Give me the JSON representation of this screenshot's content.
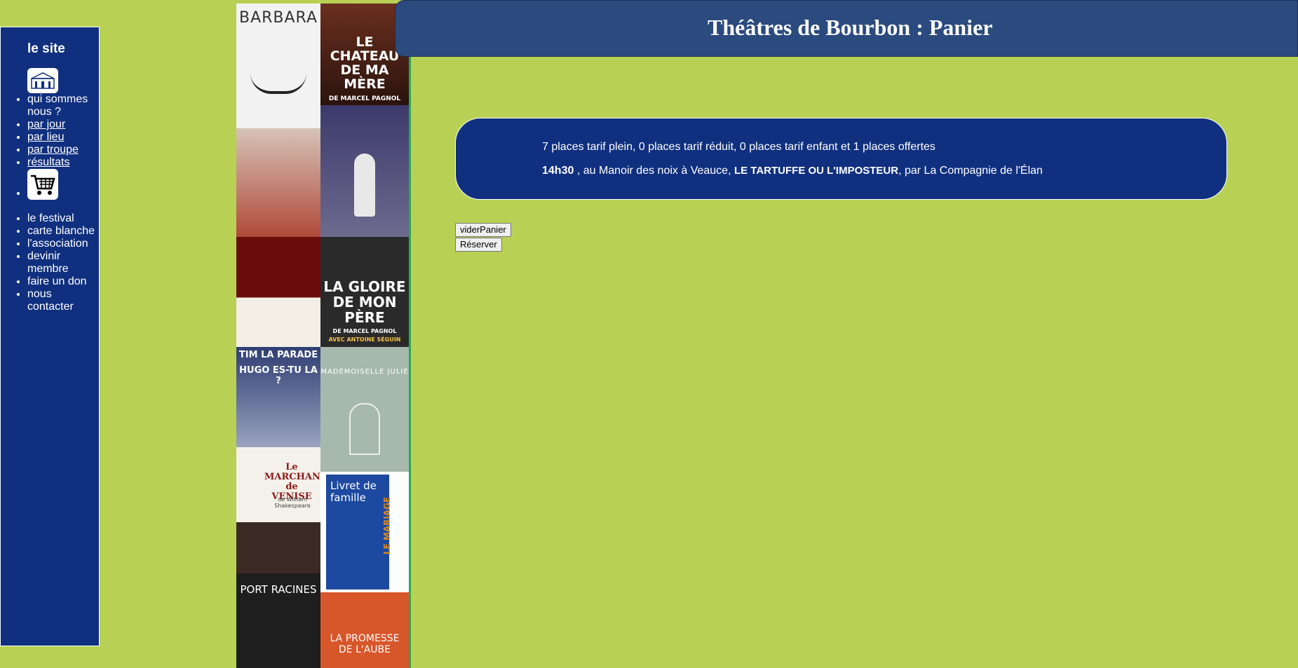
{
  "sidebar": {
    "heading": "le site",
    "items_top": [
      "qui sommes nous ?",
      "par jour",
      "par lieu",
      "par troupe",
      "résultats"
    ],
    "items_bottom": [
      "le festival",
      "carte blanche",
      "l'association",
      "devinir membre",
      "faire un don",
      "nous contacter"
    ]
  },
  "header": {
    "title": "Théâtres de Bourbon : Panier"
  },
  "cart": {
    "summary": "7 places tarif plein, 0 places tarif réduit, 0 places tarif enfant et 1 places offertes",
    "time": "14h30",
    "venue_text": " , au Manoir des noix à Veauce, ",
    "play_title": "LE TARTUFFE OU L'IMPOSTEUR",
    "company_text": ", par La Compagnie de l'Élan"
  },
  "buttons": {
    "empty": "viderPanier",
    "reserve": "Réserver"
  },
  "posters": {
    "barbara": "BARBARA",
    "chateau": "LE CHATEAU DE MA MÈRE",
    "chateau_sub": "DE MARCEL PAGNOL",
    "gloire": "LA GLOIRE DE MON PÈRE",
    "gloire_sub": "DE MARCEL PAGNOL",
    "gloire_cast": "AVEC ANTOINE SÉGUIN",
    "tim": "TIM LA PARADE",
    "hugo": "HUGO ES-TU LA ?",
    "mademoiselle": "MADEMOISELLE JULIE",
    "marchand": "Le MARCHAND de VENISE",
    "marchand_author": "de William Shakespeare",
    "livret": "Livret de famille",
    "mariage": "LE MARIAGE",
    "port": "PORT RACINES",
    "promesse": "LA PROMESSE DE L'AUBE"
  },
  "colors": {
    "background": "#b8d154",
    "navy": "#10307f",
    "header": "#2b4a7e"
  }
}
